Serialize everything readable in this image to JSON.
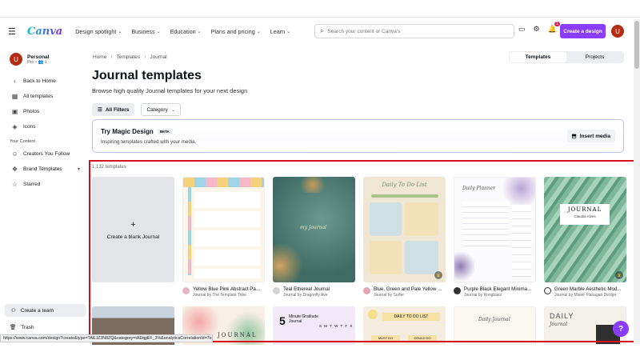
{
  "header": {
    "logo": "Canva",
    "nav": [
      "Design spotlight",
      "Business",
      "Education",
      "Plans and pricing",
      "Learn"
    ],
    "search_placeholder": "Search your content or Canva's",
    "notifications_count": "1",
    "create_label": "Create a design",
    "avatar_initial": "U"
  },
  "sidebar": {
    "account_name": "Personal",
    "account_plan": "Pro • 👥 1",
    "avatar_initial": "U",
    "back_label": "Back to Home",
    "items": [
      {
        "label": "All templates",
        "icon": "template-icon"
      },
      {
        "label": "Photos",
        "icon": "photo-icon"
      },
      {
        "label": "Icons",
        "icon": "shapes-icon"
      }
    ],
    "section_label": "Your Content",
    "content_items": [
      {
        "label": "Creators You Follow",
        "icon": "follow-icon"
      },
      {
        "label": "Brand Templates",
        "icon": "brand-icon"
      },
      {
        "label": "Starred",
        "icon": "star-icon"
      }
    ],
    "create_team": "Create a team",
    "trash": "Trash"
  },
  "breadcrumb": [
    "Home",
    "Templates",
    "Journal"
  ],
  "toggle": {
    "templates": "Templates",
    "projects": "Projects"
  },
  "page": {
    "title": "Journal templates",
    "subtitle": "Browse high quality Journal templates for your next design",
    "all_filters": "All Filters",
    "category": "Category"
  },
  "magic": {
    "title": "Try Magic Design",
    "beta": "BETA",
    "subtitle": "Inspiring templates crafted with your media.",
    "insert": "Insert media"
  },
  "template_count": "1,132 templates",
  "blank_label": "Create a blank Journal",
  "cards": [
    {
      "title": "Yellow Blue Pink Abstract Pa...",
      "author": "Journal by The Template Tribe"
    },
    {
      "title": "Teal Ethereal Journal",
      "author": "Journal by Dragonfly Ave"
    },
    {
      "title": "Blue, Green and Pale Yellow ...",
      "author": "Journal by Surfer"
    },
    {
      "title": "Purple Black Elegant Minima...",
      "author": "Journal by Rongbaez"
    },
    {
      "title": "Green Marble Aesthetic Mod...",
      "author": "Journal by Mister Flanagan Design"
    }
  ],
  "thumb_text": {
    "teal": "my Journal",
    "todo": "Daily To Do List",
    "planner": "Daily Planner",
    "marble_title": "JOURNAL",
    "marble_name": "Claudia Alves",
    "floral": "JOURNAL",
    "gratitude_num": "5",
    "gratitude": "Minute Gratitude Journal",
    "gratitude_days": "S M T W T F S",
    "todo2": "DAILY TO DO LIST",
    "todo2_col": "MUST DO",
    "todo2_col2": "COULD DO",
    "daily_j": "Daily Journal",
    "daily2": "DAILY",
    "daily2b": "Journal"
  },
  "status_url": "https://www.canva.com/design?create&type=TAEJZ3N8ZQ&category=tAEqgEF_3%&analyticsCorrelationId=7eefe1...",
  "help": "?"
}
